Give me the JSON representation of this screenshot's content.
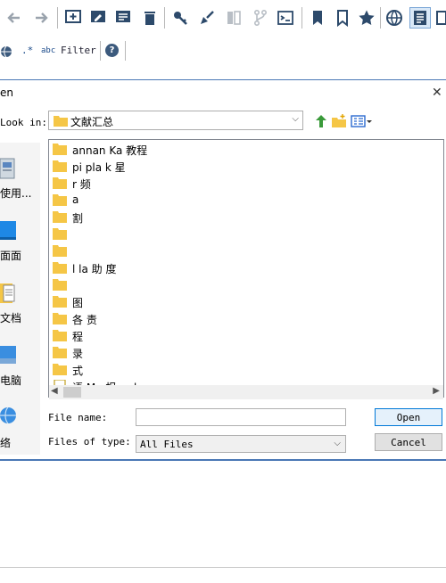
{
  "filterbar": {
    "regex_glyph": ".*",
    "case_glyph": "abc",
    "filter_label": "Filter",
    "help_glyph": "?"
  },
  "dialog": {
    "title": "en",
    "look_in_label": "Look in:",
    "current_folder": "文献汇总",
    "places": [
      {
        "label": "使用..."
      },
      {
        "label": "面面"
      },
      {
        "label": "文档"
      },
      {
        "label": "电脑"
      },
      {
        "label": "络"
      }
    ],
    "files": [
      {
        "name": "annan Ka 教程",
        "type": "folder"
      },
      {
        "name": "pi pla k 星",
        "type": "folder"
      },
      {
        "name": "r 频",
        "type": "folder"
      },
      {
        "name": "a",
        "type": "folder"
      },
      {
        "name": "割",
        "type": "folder"
      },
      {
        "name": "",
        "type": "folder"
      },
      {
        "name": "",
        "type": "folder"
      },
      {
        "name": "l la 助 度",
        "type": "folder"
      },
      {
        "name": "",
        "type": "folder"
      },
      {
        "name": "图",
        "type": "folder"
      },
      {
        "name": "各 责",
        "type": "folder"
      },
      {
        "name": "程",
        "type": "folder"
      },
      {
        "name": "录",
        "type": "folder"
      },
      {
        "name": "式",
        "type": "folder"
      },
      {
        "name": "语 Ma 报 .pd.",
        "type": "pdf"
      }
    ],
    "file_name_label": "File name:",
    "file_name_value": "",
    "file_type_label": "Files of type:",
    "file_type_value": "All Files",
    "open_label": "Open",
    "cancel_label": "Cancel"
  },
  "colors": {
    "accent": "#0078d7",
    "folder": "#f5c646",
    "dialog_border": "#4a78b5",
    "toolbar_icon": "#2d4a6b"
  }
}
